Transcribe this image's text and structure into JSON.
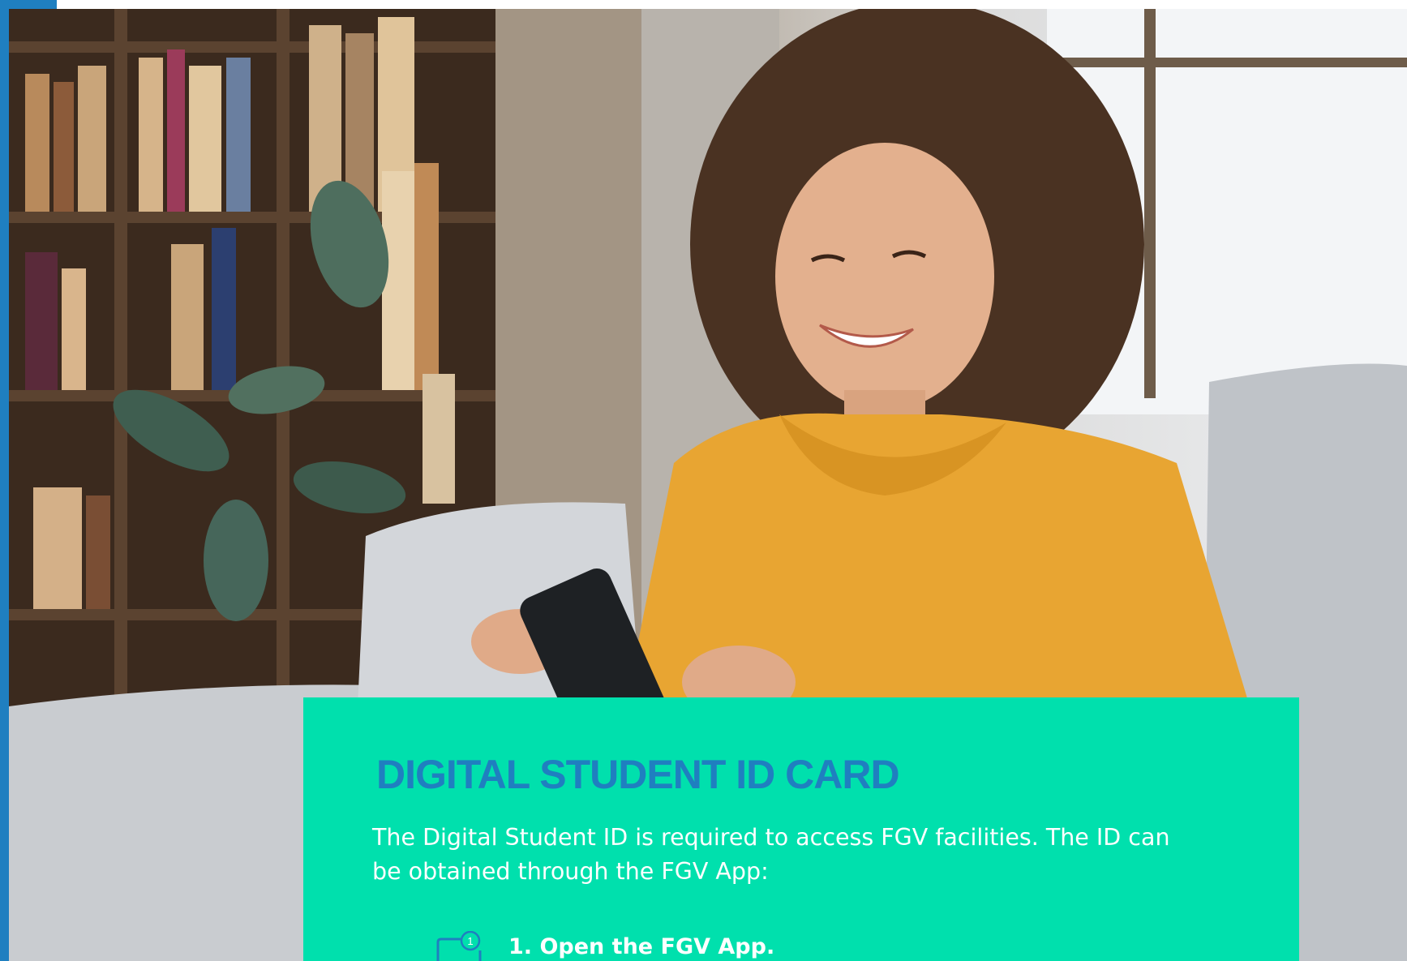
{
  "colors": {
    "accent_blue": "#1f7fc0",
    "card_green": "#00e0ad",
    "body_text": "#ffffff"
  },
  "photo": {
    "subject": "student-using-phone-photo"
  },
  "card": {
    "title": "DIGITAL STUDENT ID CARD",
    "body_line_1": "The Digital Student ID is required to access FGV facilities. The ID can",
    "body_line_2": "be obtained through the FGV App:",
    "steps": [
      {
        "number": "1",
        "label": "1. Open the FGV App.",
        "icon": "phone-step-icon"
      }
    ]
  }
}
